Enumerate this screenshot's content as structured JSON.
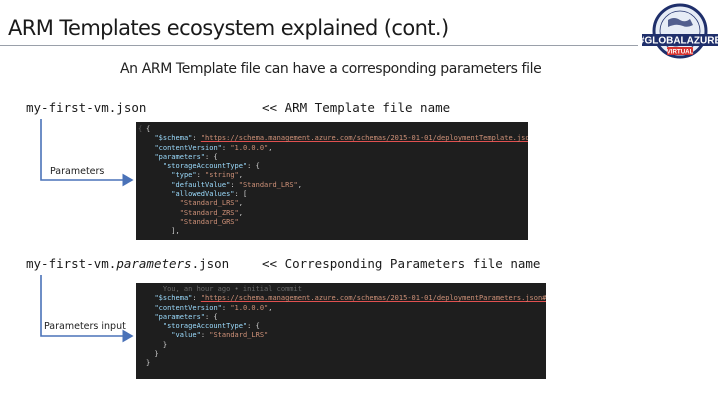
{
  "slide": {
    "title": "ARM Templates ecosystem explained (cont.)",
    "subtitle": "An ARM Template file can have a corresponding parameters file"
  },
  "logo": {
    "main_text": "#GLOBALAZURE",
    "sub_text": "VIRTUAL",
    "colors": {
      "navy": "#1f2f6b",
      "red": "#d6332f",
      "light": "#e6ecf6"
    }
  },
  "template_file": {
    "filename": "my-first-vm.json",
    "caption": "<< ARM Template file name",
    "arrow_label": "Parameters",
    "code_lines": [
      [
        {
          "c": "p",
          "t": "{"
        }
      ],
      [
        {
          "c": "p",
          "t": "  "
        },
        {
          "c": "k",
          "t": "\"$schema\""
        },
        {
          "c": "p",
          "t": ": "
        },
        {
          "c": "u",
          "t": "\"https://schema.management.azure.com/schemas/2015-01-01/deploymentTemplate.json#\""
        },
        {
          "c": "p",
          "t": ","
        }
      ],
      [
        {
          "c": "p",
          "t": "  "
        },
        {
          "c": "k",
          "t": "\"contentVersion\""
        },
        {
          "c": "p",
          "t": ": "
        },
        {
          "c": "s",
          "t": "\"1.0.0.0\""
        },
        {
          "c": "p",
          "t": ","
        }
      ],
      [
        {
          "c": "p",
          "t": "  "
        },
        {
          "c": "k",
          "t": "\"parameters\""
        },
        {
          "c": "p",
          "t": ": {"
        }
      ],
      [
        {
          "c": "p",
          "t": "    "
        },
        {
          "c": "k",
          "t": "\"storageAccountType\""
        },
        {
          "c": "p",
          "t": ": {"
        }
      ],
      [
        {
          "c": "p",
          "t": "      "
        },
        {
          "c": "k",
          "t": "\"type\""
        },
        {
          "c": "p",
          "t": ": "
        },
        {
          "c": "s",
          "t": "\"string\""
        },
        {
          "c": "p",
          "t": ","
        }
      ],
      [
        {
          "c": "p",
          "t": "      "
        },
        {
          "c": "k",
          "t": "\"defaultValue\""
        },
        {
          "c": "p",
          "t": ": "
        },
        {
          "c": "s",
          "t": "\"Standard_LRS\""
        },
        {
          "c": "p",
          "t": ","
        }
      ],
      [
        {
          "c": "p",
          "t": "      "
        },
        {
          "c": "k",
          "t": "\"allowedValues\""
        },
        {
          "c": "p",
          "t": ": ["
        }
      ],
      [
        {
          "c": "p",
          "t": "        "
        },
        {
          "c": "s",
          "t": "\"Standard_LRS\""
        },
        {
          "c": "p",
          "t": ","
        }
      ],
      [
        {
          "c": "p",
          "t": "        "
        },
        {
          "c": "s",
          "t": "\"Standard_ZRS\""
        },
        {
          "c": "p",
          "t": ","
        }
      ],
      [
        {
          "c": "p",
          "t": "        "
        },
        {
          "c": "s",
          "t": "\"Standard_GRS\""
        }
      ],
      [
        {
          "c": "p",
          "t": "      ],"
        }
      ]
    ]
  },
  "parameters_file": {
    "filename_prefix": "my-first-vm.",
    "filename_italic": "parameters",
    "filename_suffix": ".json",
    "caption": "<< Corresponding Parameters file name",
    "arrow_label": "Parameters input",
    "code_lines": [
      [
        {
          "c": "g",
          "t": "    You, an hour ago • initial commit"
        }
      ],
      [
        {
          "c": "p",
          "t": "  "
        },
        {
          "c": "k",
          "t": "\"$schema\""
        },
        {
          "c": "p",
          "t": ": "
        },
        {
          "c": "u",
          "t": "\"https://schema.management.azure.com/schemas/2015-01-01/deploymentParameters.json#\""
        },
        {
          "c": "p",
          "t": ","
        }
      ],
      [
        {
          "c": "p",
          "t": "  "
        },
        {
          "c": "k",
          "t": "\"contentVersion\""
        },
        {
          "c": "p",
          "t": ": "
        },
        {
          "c": "s",
          "t": "\"1.0.0.0\""
        },
        {
          "c": "p",
          "t": ","
        }
      ],
      [
        {
          "c": "p",
          "t": "  "
        },
        {
          "c": "k",
          "t": "\"parameters\""
        },
        {
          "c": "p",
          "t": ": {"
        }
      ],
      [
        {
          "c": "p",
          "t": "    "
        },
        {
          "c": "k",
          "t": "\"storageAccountType\""
        },
        {
          "c": "p",
          "t": ": {"
        }
      ],
      [
        {
          "c": "p",
          "t": "      "
        },
        {
          "c": "k",
          "t": "\"value\""
        },
        {
          "c": "p",
          "t": ": "
        },
        {
          "c": "s",
          "t": "\"Standard_LRS\""
        }
      ],
      [
        {
          "c": "p",
          "t": "    }"
        }
      ],
      [
        {
          "c": "p",
          "t": "  }"
        }
      ],
      [
        {
          "c": "p",
          "t": "}"
        }
      ]
    ]
  }
}
